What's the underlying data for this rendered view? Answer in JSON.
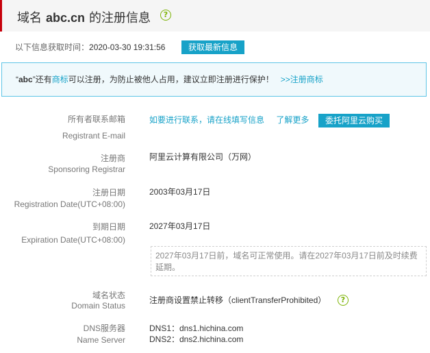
{
  "header": {
    "prefix": "域名",
    "domain": "abc.cn",
    "suffix": "的注册信息"
  },
  "fetch": {
    "label": "以下信息获取时间：",
    "time": "2020-03-30 19:31:56",
    "button": "获取最新信息"
  },
  "notice": {
    "q_open": "“",
    "name": "abc",
    "q_close": "”",
    "text_a": "还有",
    "link_trademark": "商标",
    "text_b": "可以注册，为防止被他人占用，建议立即注册进行保护！",
    "link_register": ">>注册商标"
  },
  "fields": {
    "email": {
      "label_cn": "所有者联系邮箱",
      "label_en": "Registrant E-mail",
      "contact_link": "如要进行联系，请在线填写信息",
      "more_link": "了解更多",
      "buy_button": "委托阿里云购买"
    },
    "registrar": {
      "label_cn": "注册商",
      "label_en": "Sponsoring Registrar",
      "value": "阿里云计算有限公司（万网）"
    },
    "reg_date": {
      "label_cn": "注册日期",
      "label_en": "Registration Date(UTC+08:00)",
      "value": "2003年03月17日"
    },
    "exp_date": {
      "label_cn": "到期日期",
      "label_en": "Expiration Date(UTC+08:00)",
      "value": "2027年03月17日",
      "note_line1": "2027年03月17日前，域名可正常使用。请在2027年03月17日前及时续费",
      "note_line2": "延期。"
    },
    "status": {
      "label_cn": "域名状态",
      "label_en": "Domain Status",
      "value": "注册商设置禁止转移（clientTransferProhibited）"
    },
    "dns": {
      "label_cn": "DNS服务器",
      "label_en": "Name Server",
      "dns1": "DNS1：dns1.hichina.com",
      "dns2": "DNS2：dns2.hichina.com"
    }
  },
  "icons": {
    "help": "question-circle-icon",
    "help_glyph": "?"
  },
  "colors": {
    "accent": "#17a2c8",
    "header_bar": "#c7000b",
    "help_green": "#7cb305"
  }
}
